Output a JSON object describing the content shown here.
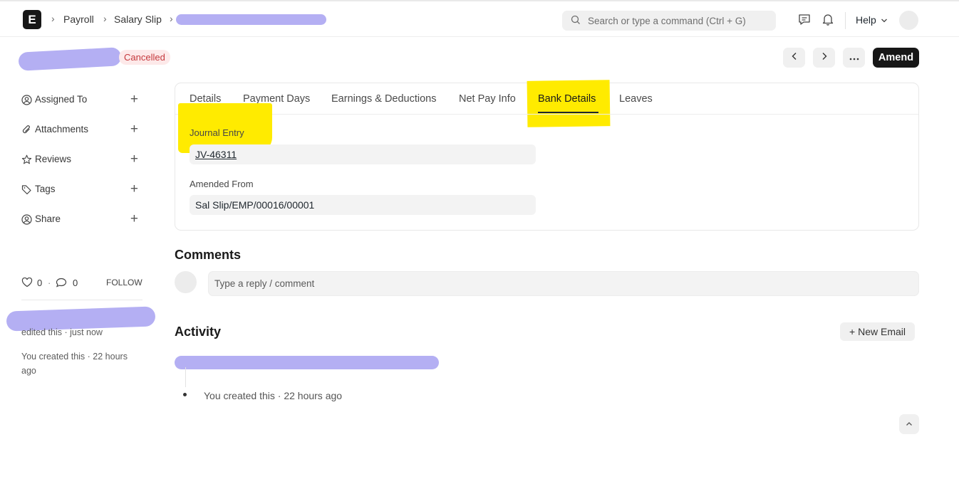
{
  "header": {
    "logo_letter": "E",
    "breadcrumbs": [
      "Payroll",
      "Salary Slip"
    ],
    "search_placeholder": "Search or type a command (Ctrl + G)",
    "help_label": "Help"
  },
  "doc": {
    "status": "Cancelled",
    "status_color": "#c5393d",
    "primary_action": "Amend"
  },
  "sidebar": {
    "items": [
      {
        "label": "Assigned To",
        "icon": "user-icon"
      },
      {
        "label": "Attachments",
        "icon": "paperclip-icon"
      },
      {
        "label": "Reviews",
        "icon": "star-icon"
      },
      {
        "label": "Tags",
        "icon": "tag-icon"
      },
      {
        "label": "Share",
        "icon": "share-user-icon"
      }
    ],
    "likes_count": "0",
    "comments_count": "0",
    "follow_label": "FOLLOW",
    "edited_text": "edited this · just now",
    "created_text": "You created this · 22 hours ago"
  },
  "tabs": [
    "Details",
    "Payment Days",
    "Earnings & Deductions",
    "Net Pay Info",
    "Bank Details",
    "Leaves"
  ],
  "active_tab": "Bank Details",
  "fields": {
    "journal_entry_label": "Journal Entry",
    "journal_entry_value": "JV-46311",
    "amended_from_label": "Amended From",
    "amended_from_value": "Sal Slip/EMP/00016/00001"
  },
  "comments": {
    "title": "Comments",
    "placeholder": "Type a reply / comment"
  },
  "activity": {
    "title": "Activity",
    "new_email_label": "+ New Email",
    "items": [
      "You created this · 22 hours ago"
    ]
  },
  "colors": {
    "highlight": "#ffeb00",
    "redaction": "#b4aff3",
    "primary_button": "#171717"
  }
}
